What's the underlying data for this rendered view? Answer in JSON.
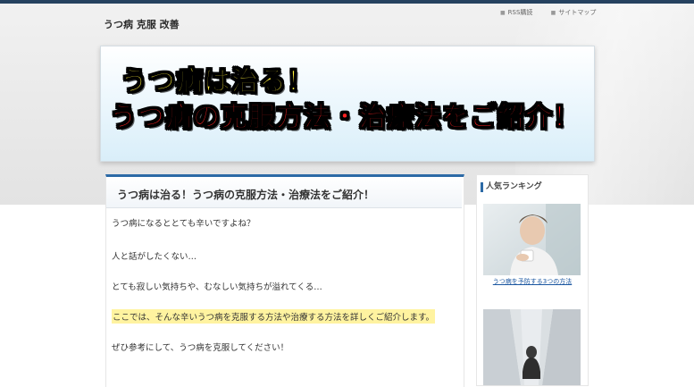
{
  "site": {
    "title": "うつ病 克服 改善",
    "links": [
      "RSS購読",
      "サイトマップ"
    ]
  },
  "banner": {
    "line1": "うつ病は治る！",
    "line2": "うつ病の克服方法・治療法をご紹介！"
  },
  "article": {
    "title": "うつ病は治る！うつ病の克服方法・治療法をご紹介！",
    "paragraphs": [
      "うつ病になるととても辛いですよね？",
      "人と話がしたくない…",
      "とても寂しい気持ちや、むなしい気持ちが溢れてくる…",
      "ここでは、そんな辛いうつ病を克服する方法や治療する方法を詳しくご紹介します。",
      "ぜひ参考にして、うつ病を克服してください！"
    ]
  },
  "sidebar": {
    "heading": "人気ランキング",
    "items": [
      {
        "link": "うつ病を予防する3つの方法"
      }
    ]
  },
  "colors": {
    "accent": "#2c6aa6",
    "highlight": "#fff3a0",
    "banner_yellow": "#ffef3a",
    "banner_red": "#ff2222"
  }
}
